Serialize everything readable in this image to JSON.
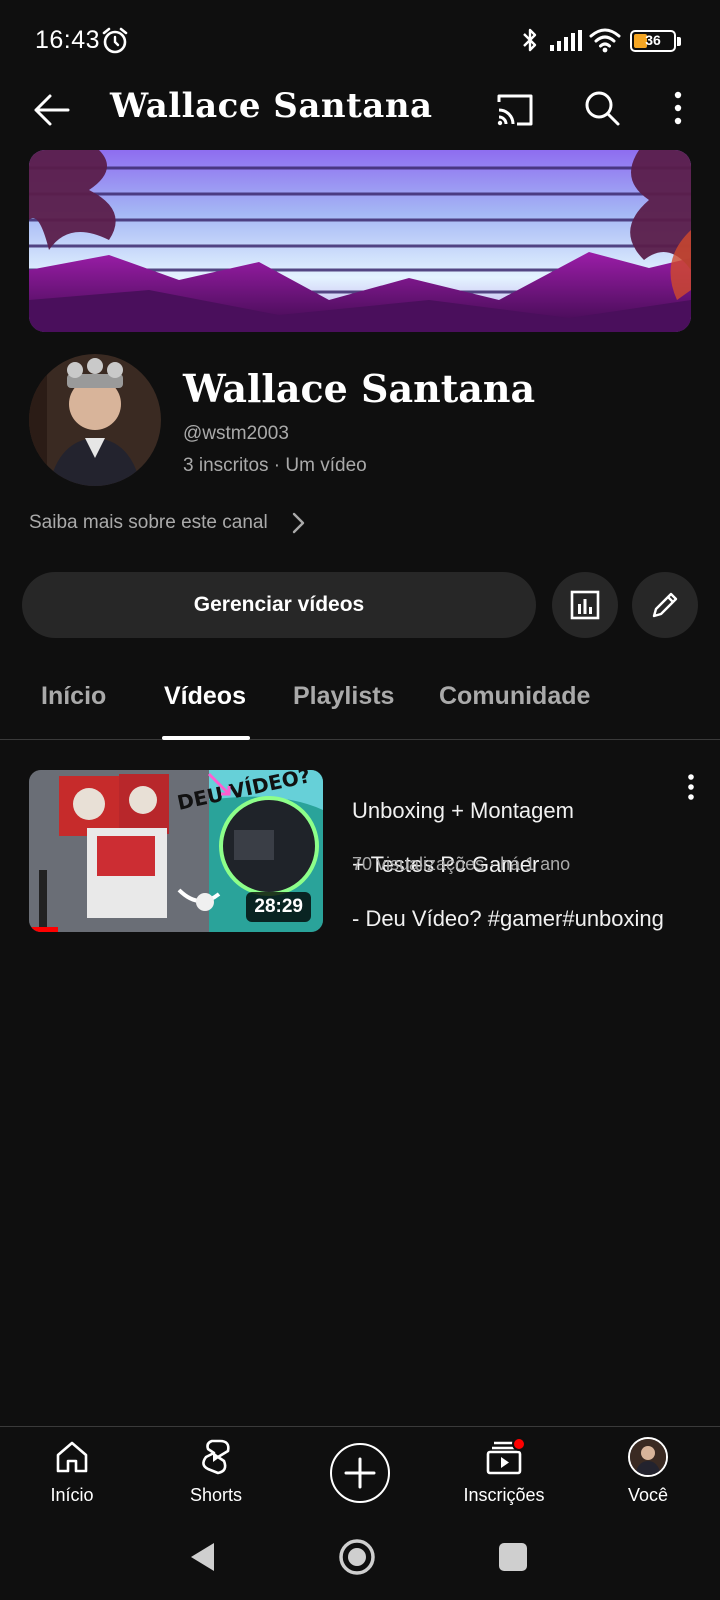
{
  "status_bar": {
    "time": "16:43",
    "battery_level": "36",
    "icons": [
      "alarm-icon",
      "bluetooth-icon",
      "signal-icon",
      "wifi-icon",
      "battery-icon"
    ]
  },
  "app_bar": {
    "title": "Wallace Santana",
    "icons": [
      "back-arrow-icon",
      "cast-icon",
      "search-icon",
      "more-vertical-icon"
    ]
  },
  "channel": {
    "name": "Wallace Santana",
    "handle": "@wstm2003",
    "stats": "3 inscritos · Um vídeo",
    "about": "Saiba mais sobre este canal"
  },
  "actions": {
    "manage_label": "Gerenciar vídeos",
    "icons": [
      "analytics-icon",
      "edit-pencil-icon"
    ]
  },
  "tabs": [
    {
      "label": "Início",
      "active": false
    },
    {
      "label": "Vídeos",
      "active": true
    },
    {
      "label": "Playlists",
      "active": false
    },
    {
      "label": "Comunidade",
      "active": false
    }
  ],
  "videos": [
    {
      "title_line1": "Unboxing + Montagem",
      "title_line2": "+ Testes Pc  Gamer",
      "title_line3": "- Deu Vídeo?   #gamer#unboxing",
      "meta": "70 visualizações · há 1 ano",
      "duration": "28:29",
      "thumb_text": "DEU VÍDEO?",
      "watch_progress": 0.1
    }
  ],
  "bottom_nav": [
    {
      "label": "Início",
      "icon": "home-icon"
    },
    {
      "label": "Shorts",
      "icon": "shorts-icon"
    },
    {
      "label": "",
      "icon": "create-plus-icon"
    },
    {
      "label": "Inscrições",
      "icon": "subscriptions-icon"
    },
    {
      "label": "Você",
      "icon": "avatar"
    }
  ],
  "colors": {
    "background": "#0f0f0f",
    "surface": "#272727",
    "secondary_text": "#aaaaaa",
    "accent_red": "#ff0000",
    "battery": "#f5a623"
  }
}
